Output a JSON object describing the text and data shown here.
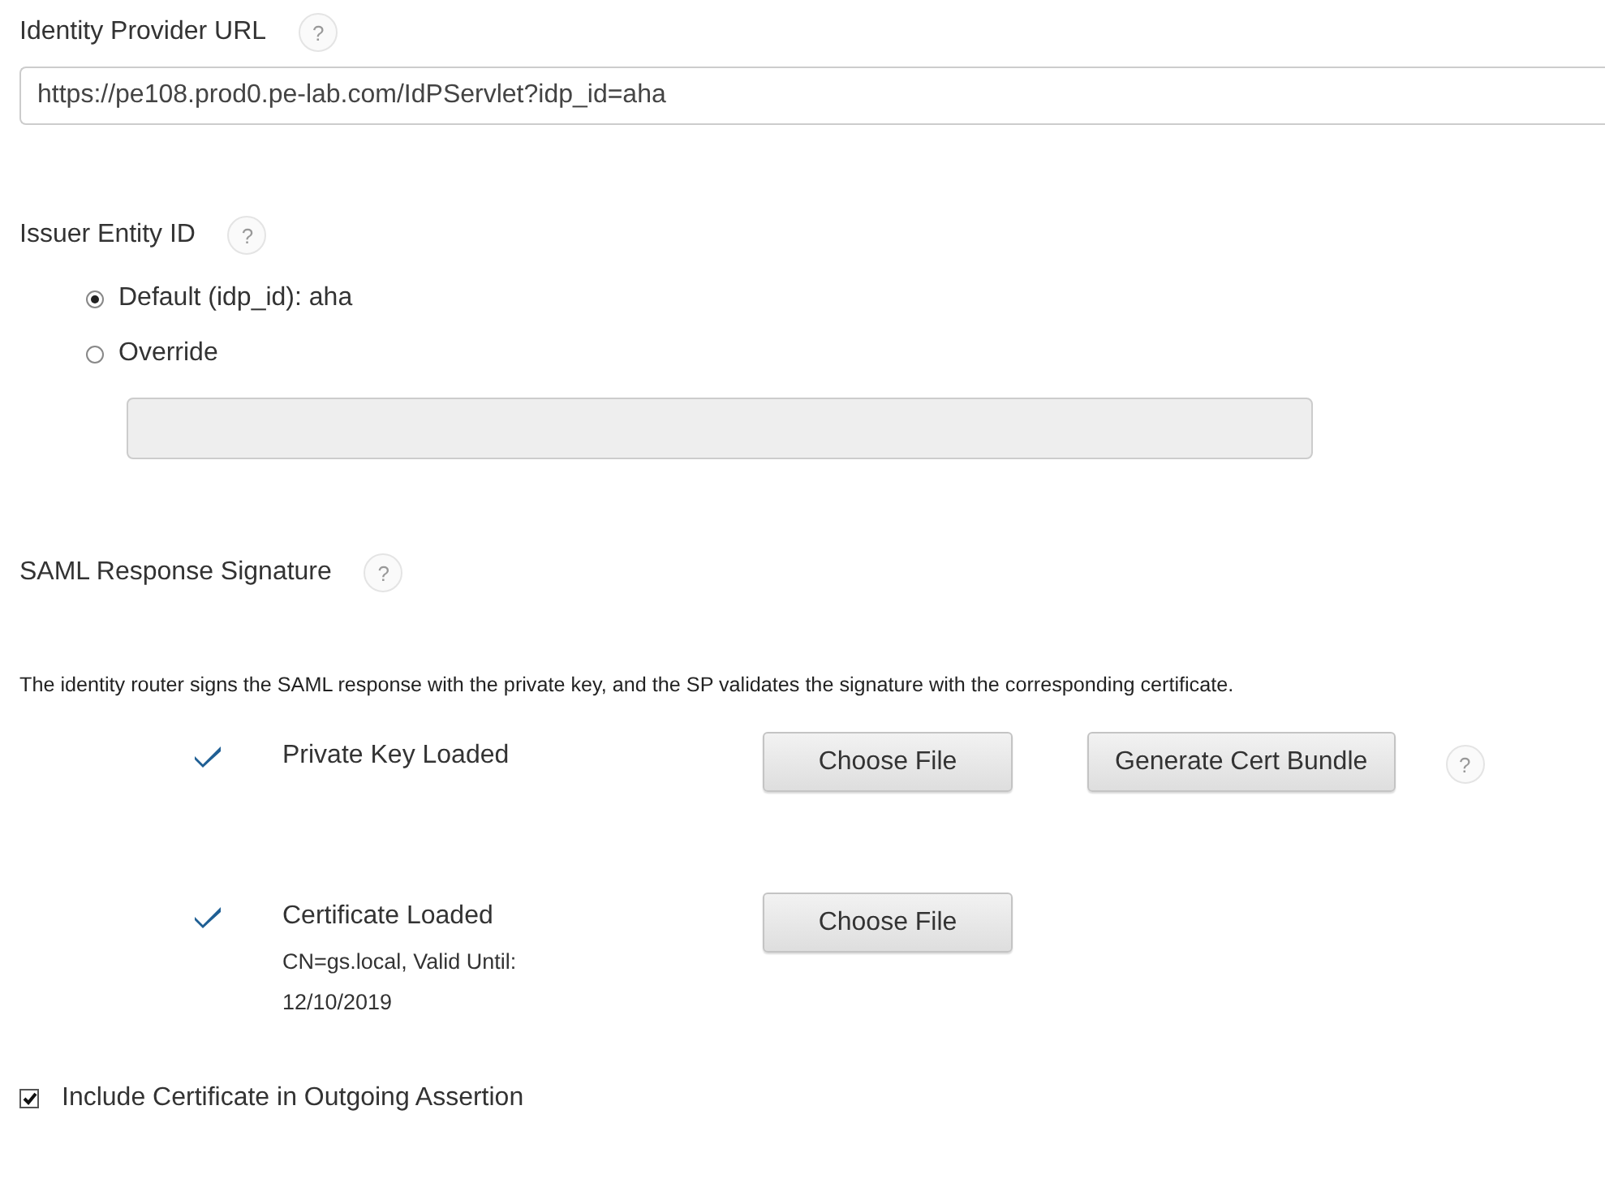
{
  "identity_provider_url": {
    "label": "Identity Provider URL",
    "help": "?",
    "value": "https://pe108.prod0.pe-lab.com/IdPServlet?idp_id=aha"
  },
  "issuer_entity_id": {
    "label": "Issuer Entity ID",
    "help": "?",
    "options": [
      {
        "label": "Default (idp_id): aha",
        "selected": true
      },
      {
        "label": "Override",
        "selected": false
      }
    ],
    "override_field": {
      "disabled": true
    }
  },
  "saml_response_signature": {
    "label": "SAML Response Signature",
    "help": "?",
    "description": "The identity router signs the SAML response with the private key, and the SP validates the signature with the corresponding certificate.",
    "items": [
      {
        "label": "Private Key Loaded",
        "loaded": true,
        "buttons": [
          "Choose File",
          "Generate Cert Bundle"
        ],
        "help": "?"
      },
      {
        "label": "Certificate Loaded",
        "loaded": true,
        "buttons": [
          "Choose File"
        ],
        "detail": "CN=gs.local, Valid Until: 12/10/2019"
      }
    ]
  },
  "include_certificate": {
    "label": "Include Certificate in Outgoing Assertion",
    "checked": true
  }
}
